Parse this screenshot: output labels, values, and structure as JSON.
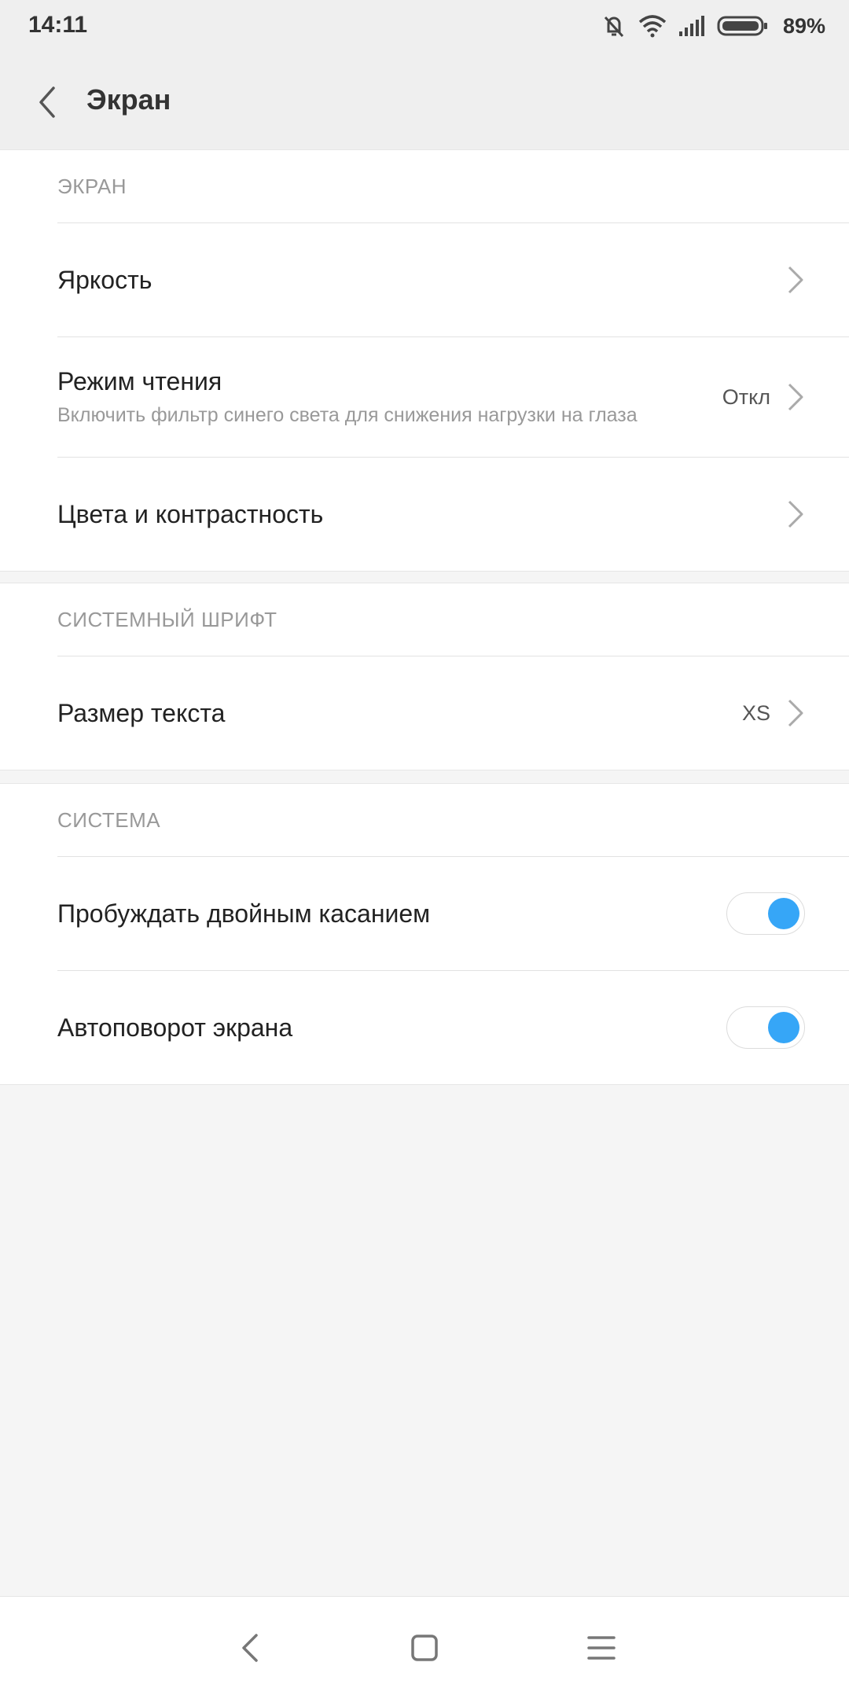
{
  "status": {
    "time": "14:11",
    "battery": "89%"
  },
  "header": {
    "title": "Экран"
  },
  "sections": [
    {
      "title": "ЭКРАН",
      "items": [
        {
          "title": "Яркость"
        },
        {
          "title": "Режим чтения",
          "subtitle": "Включить фильтр синего света для снижения нагрузки на глаза",
          "value": "Откл"
        },
        {
          "title": "Цвета и контрастность"
        }
      ]
    },
    {
      "title": "СИСТЕМНЫЙ ШРИФТ",
      "items": [
        {
          "title": "Размер текста",
          "value": "XS"
        }
      ]
    },
    {
      "title": "СИСТЕМА",
      "items": [
        {
          "title": "Пробуждать двойным касанием",
          "toggle": true
        },
        {
          "title": "Автоповорот экрана",
          "toggle": true
        }
      ]
    }
  ],
  "icons": {
    "back": "chevron-left-icon",
    "chevron": "chevron-right-icon",
    "mute": "vibrate-off-icon",
    "wifi": "wifi-icon",
    "signal": "signal-icon",
    "battery": "battery-icon"
  },
  "colors": {
    "accent": "#36a6f7",
    "background": "#f5f5f5",
    "header": "#efefef"
  }
}
